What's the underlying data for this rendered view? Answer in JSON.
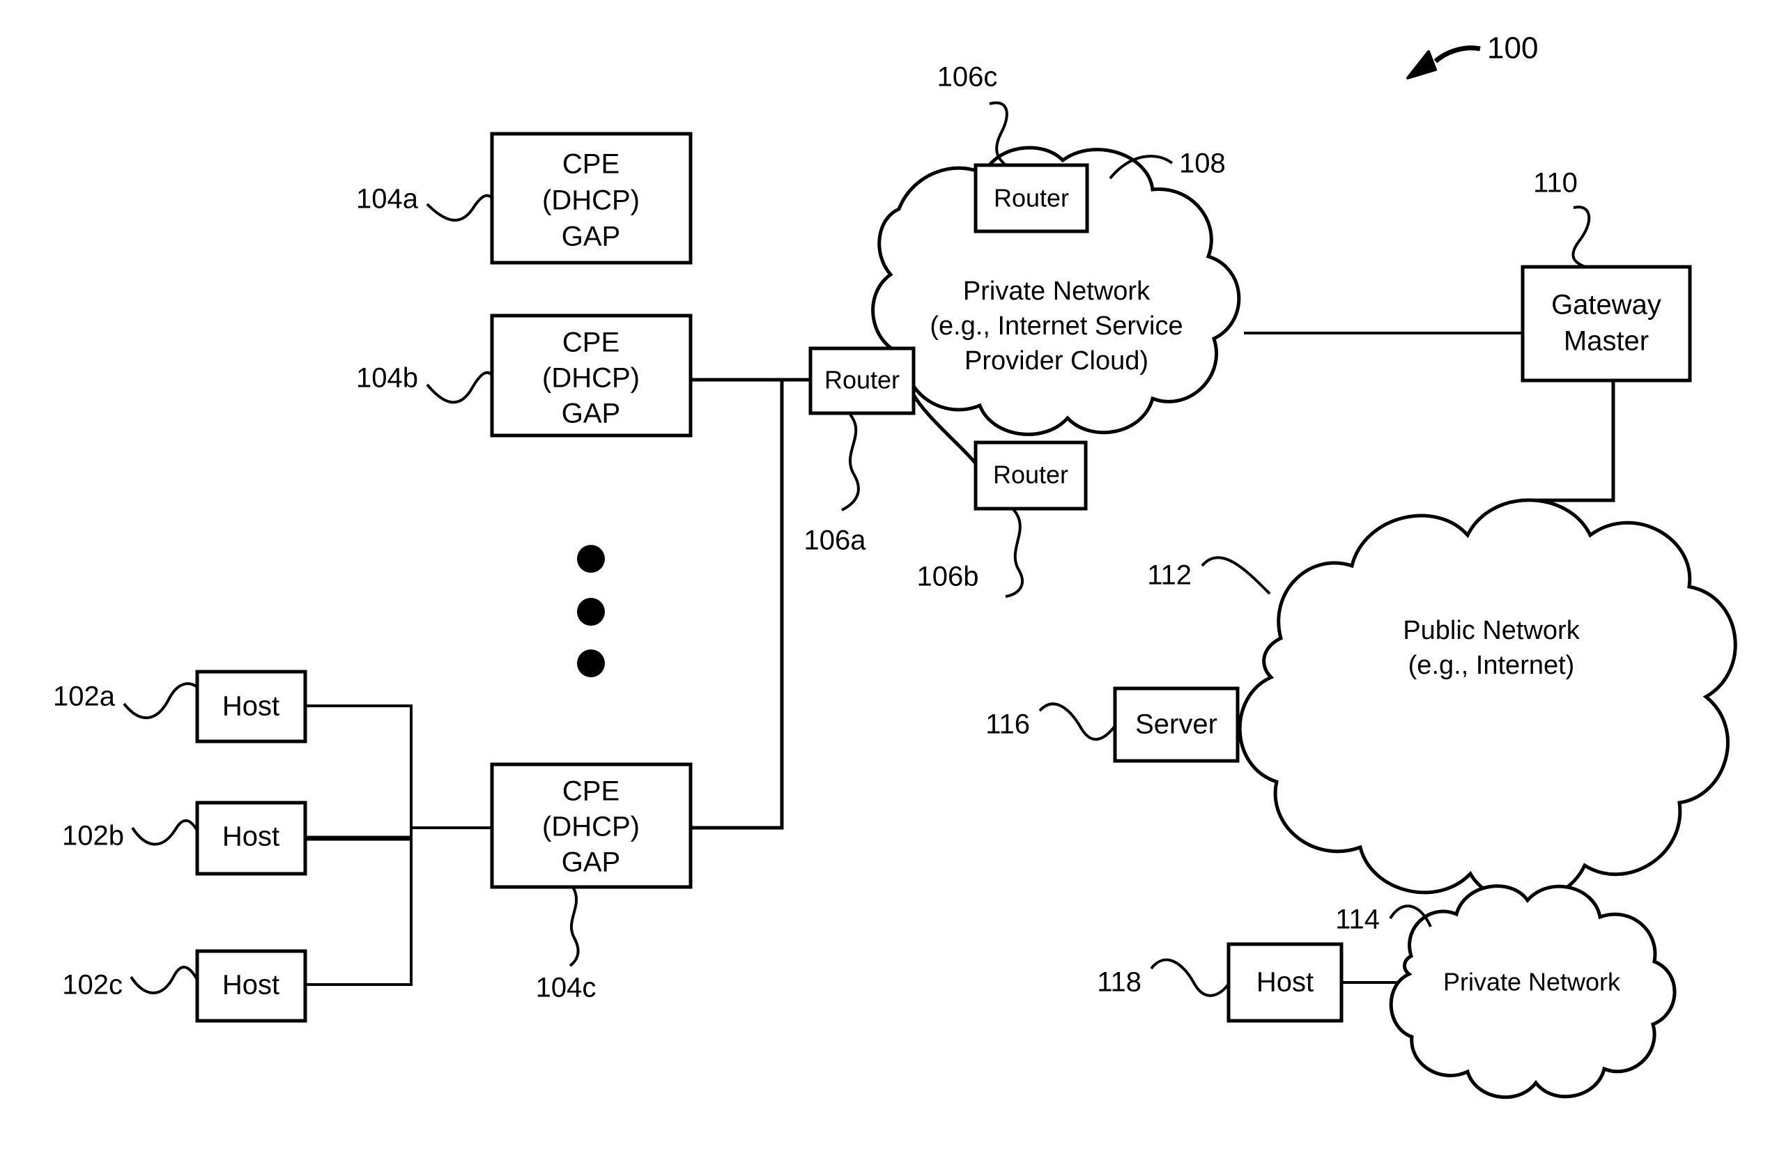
{
  "figure": {
    "reference": "100"
  },
  "nodes": {
    "cpe_a": {
      "lines": [
        "CPE",
        "(DHCP)",
        "GAP"
      ],
      "ref": "104a"
    },
    "cpe_b": {
      "lines": [
        "CPE",
        "(DHCP)",
        "GAP"
      ],
      "ref": "104b"
    },
    "cpe_c": {
      "lines": [
        "CPE",
        "(DHCP)",
        "GAP"
      ],
      "ref": "104c"
    },
    "host_a": {
      "label": "Host",
      "ref": "102a"
    },
    "host_b": {
      "label": "Host",
      "ref": "102b"
    },
    "host_c": {
      "label": "Host",
      "ref": "102c"
    },
    "router_a": {
      "label": "Router",
      "ref": "106a"
    },
    "router_b": {
      "label": "Router",
      "ref": "106b"
    },
    "router_c": {
      "label": "Router",
      "ref": "106c"
    },
    "private_network_isp": {
      "lines": [
        "Private Network",
        "(e.g., Internet Service",
        "Provider Cloud)"
      ],
      "ref": "108"
    },
    "gateway_master": {
      "lines": [
        "Gateway",
        "Master"
      ],
      "ref": "110"
    },
    "public_network": {
      "lines": [
        "Public Network",
        "(e.g., Internet)"
      ],
      "ref": "112"
    },
    "private_network_remote": {
      "label": "Private Network",
      "ref": "114"
    },
    "server": {
      "label": "Server",
      "ref": "116"
    },
    "host_remote": {
      "label": "Host",
      "ref": "118"
    }
  },
  "ellipsis": {
    "dots": 3,
    "description": "vertical-ellipsis"
  },
  "colors": {
    "stroke": "#000000",
    "fill": "#ffffff",
    "text": "#000000"
  }
}
